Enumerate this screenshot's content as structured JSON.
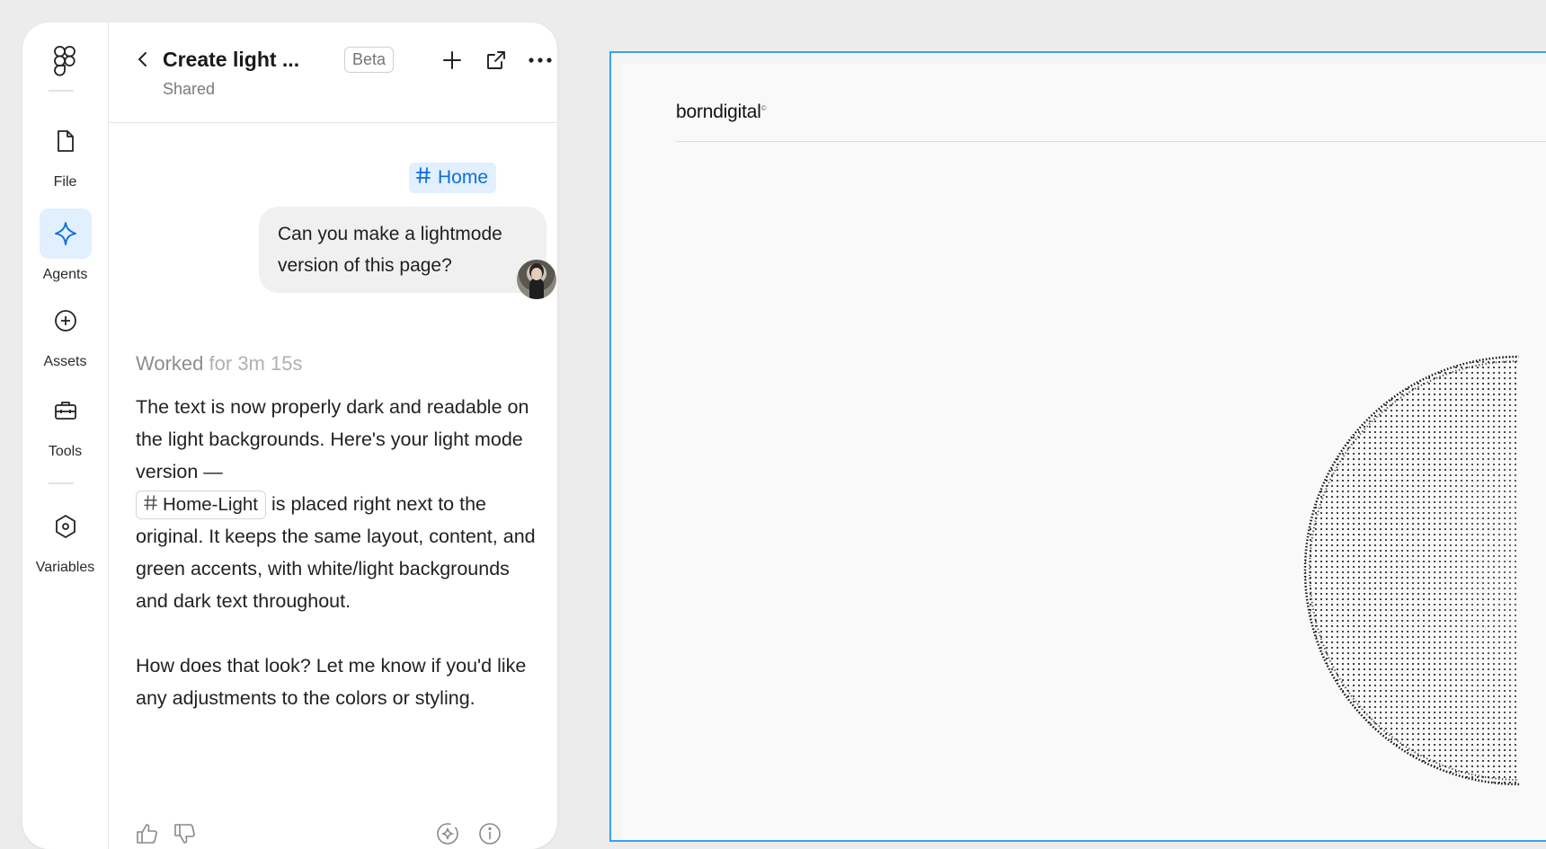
{
  "rail": {
    "items": [
      {
        "label": "File",
        "icon": "file-icon"
      },
      {
        "label": "Agents",
        "icon": "sparkle-icon",
        "active": true
      },
      {
        "label": "Assets",
        "icon": "plus-circle-icon"
      },
      {
        "label": "Tools",
        "icon": "toolbox-icon"
      },
      {
        "label": "Variables",
        "icon": "hexagon-icon"
      }
    ]
  },
  "chat": {
    "title": "Create light ...",
    "subtitle": "Shared",
    "badge": "Beta",
    "context_tag": "Home",
    "user_message": "Can you make a lightmode version of this page?",
    "worked_label": "Worked",
    "worked_duration": "for 3m 15s",
    "reply_part1": "The text is now properly dark and readable on the light backgrounds. Here's your light mode version —",
    "reply_tag": "Home-Light",
    "reply_part2": "is placed right next to the original. It keeps the same layout, content, and green accents, with white/light backgrounds and dark text throughout.",
    "reply_followup": "How does that look? Let me know if you'd like any adjustments to the colors or styling."
  },
  "canvas": {
    "brand": "borndigital",
    "brand_mark": "©"
  },
  "colors": {
    "accent": "#0d6fd8",
    "accent_bg": "#e1efff",
    "selection": "#3aa0ef"
  }
}
